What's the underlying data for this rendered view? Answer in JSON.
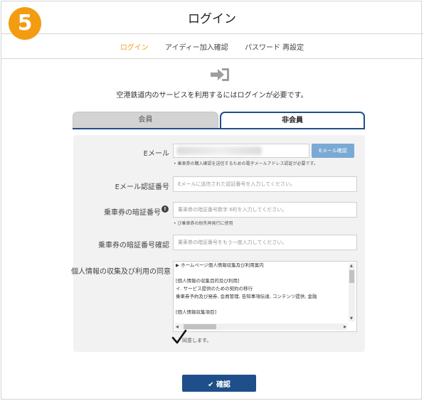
{
  "badge": "5",
  "header": {
    "title": "ログイン"
  },
  "tabs": [
    {
      "label": "ログイン",
      "active": true
    },
    {
      "label": "アイディー加入確認",
      "active": false
    },
    {
      "label": "パスワード 再設定",
      "active": false
    }
  ],
  "icon": "login-arrow-icon",
  "notice": "空港鉄道内のサービスを利用するにはログインが必要です。",
  "member_tabs": {
    "member": "会員",
    "nonmember": "非会員"
  },
  "form": {
    "email": {
      "label": "Eメール",
      "button": "Eメール確認",
      "hint": "乗車券の購入確認を送信するための電子メールアドレス認証が必要です。"
    },
    "email_code": {
      "label": "Eメール認証番号",
      "placeholder": "Eメールに送信された認証番号を入力してください。"
    },
    "pin": {
      "label": "乗車券の暗証番号",
      "placeholder": "乗車券の暗証番号数字 6桁を入力してください。",
      "hint": "び乗車券の紛失再発行に使用"
    },
    "pin_confirm": {
      "label": "乗車券の暗証番号確認",
      "placeholder": "乗車券の暗証番号をもう一度入力してください。"
    },
    "privacy": {
      "label": "個人情報の収集及び利用の同意",
      "lines": [
        "ホームページ個人情報収集及び利用案内",
        "",
        "[個人情報の収集目的及び利用]",
        "イ. サービス提供のための契約の移行",
        "乗車券予約及び発券, 会員管理, 告知事項伝達, コンテンツ提供, 金融",
        "",
        "[個人情報収集項目]"
      ]
    },
    "agree": "同意します。"
  },
  "confirm_button": "確認",
  "colors": {
    "accent": "#f39c12",
    "primary": "#1f4f8a",
    "email_button": "#7aaad4"
  }
}
